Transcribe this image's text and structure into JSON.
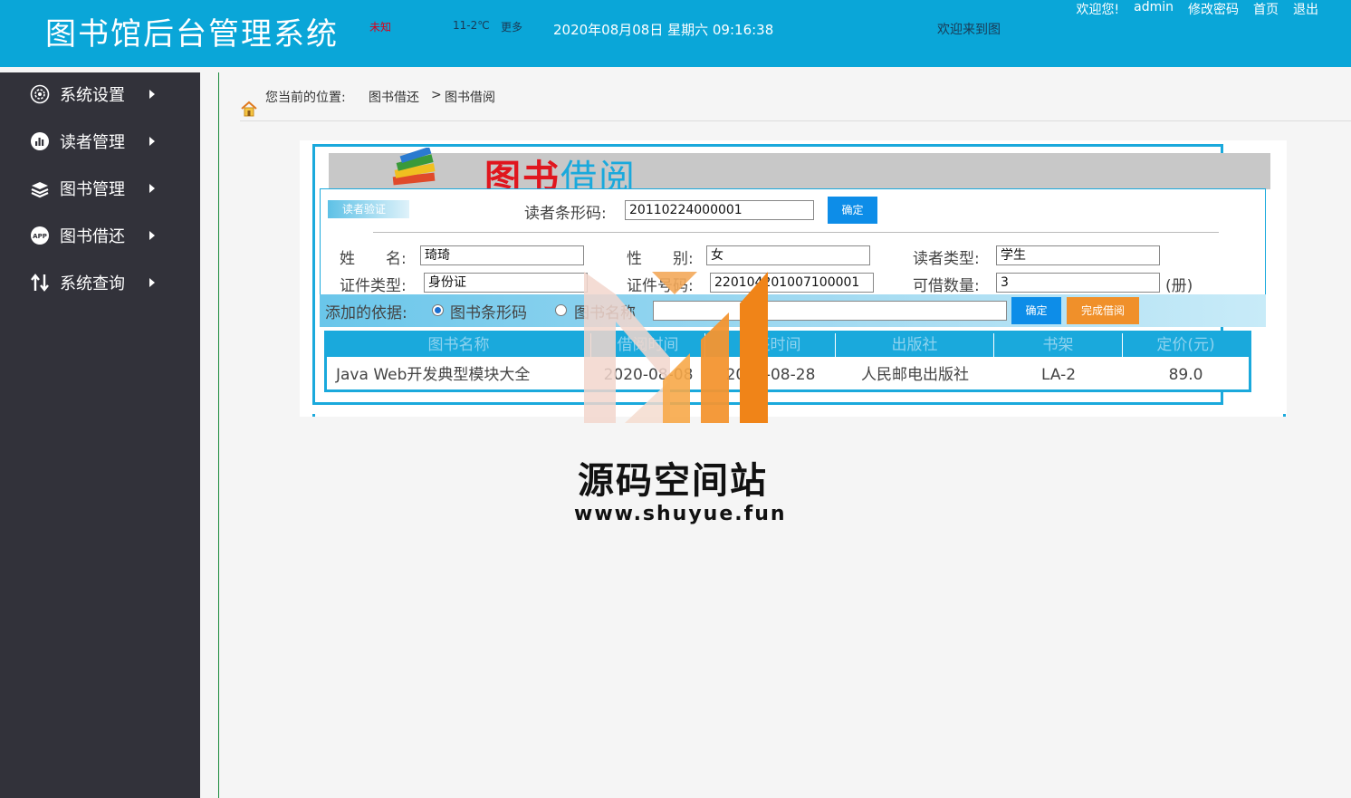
{
  "header": {
    "title": "图书馆后台管理系统",
    "weather_location": "未知",
    "weather_temp": "11-2℃",
    "weather_more": "更多",
    "datetime": "2020年08月08日 星期六 09:16:38",
    "marquee": "欢迎来到图",
    "greeting": "欢迎您!",
    "user": "admin",
    "change_password": "修改密码",
    "home": "首页",
    "logout": "退出"
  },
  "sidebar": {
    "items": [
      {
        "label": "系统设置",
        "icon": "gear-icon"
      },
      {
        "label": "读者管理",
        "icon": "chart-icon"
      },
      {
        "label": "图书管理",
        "icon": "stack-icon"
      },
      {
        "label": "图书借还",
        "icon": "app-icon"
      },
      {
        "label": "系统查询",
        "icon": "swap-icon"
      }
    ]
  },
  "breadcrumb": {
    "prefix": "您当前的位置:",
    "crumb1": "图书借还",
    "sep": ">",
    "crumb2": "图书借阅"
  },
  "banner": {
    "title_red": "图书",
    "title_blue": "借阅"
  },
  "form": {
    "verify_tag": "读者验证",
    "barcode_label": "读者条形码:",
    "barcode_value": "20110224000001",
    "confirm_label": "确定",
    "name_label": "姓　　名:",
    "name_value": "琦琦",
    "gender_label": "性　　别:",
    "gender_value": "女",
    "reader_type_label": "读者类型:",
    "reader_type_value": "学生",
    "id_type_label": "证件类型:",
    "id_type_value": "身份证",
    "id_number_label": "证件号码:",
    "id_number_value": "220104201007100001",
    "borrowable_label": "可借数量:",
    "borrowable_value": "3",
    "unit": "(册)"
  },
  "add_bar": {
    "label": "添加的依据:",
    "option_barcode": "图书条形码",
    "option_name": "图书名称",
    "selected": "图书条形码",
    "input_value": "",
    "confirm_label": "确定",
    "finish_label": "完成借阅"
  },
  "table": {
    "headers": [
      "图书名称",
      "借阅时间",
      "归还时间",
      "出版社",
      "书架",
      "定价(元)"
    ],
    "rows": [
      [
        "Java Web开发典型模块大全",
        "2020-08-08",
        "2020-08-28",
        "人民邮电出版社",
        "LA-2",
        "89.0"
      ]
    ]
  },
  "watermark": {
    "name": "源码空间站",
    "url": "www.shuyue.fun"
  },
  "colors": {
    "header_bg": "#0aa6d8",
    "sidebar_bg": "#32323a",
    "accent": "#1aa9dc",
    "button_blue": "#0d8de8",
    "button_orange": "#f0902a"
  }
}
